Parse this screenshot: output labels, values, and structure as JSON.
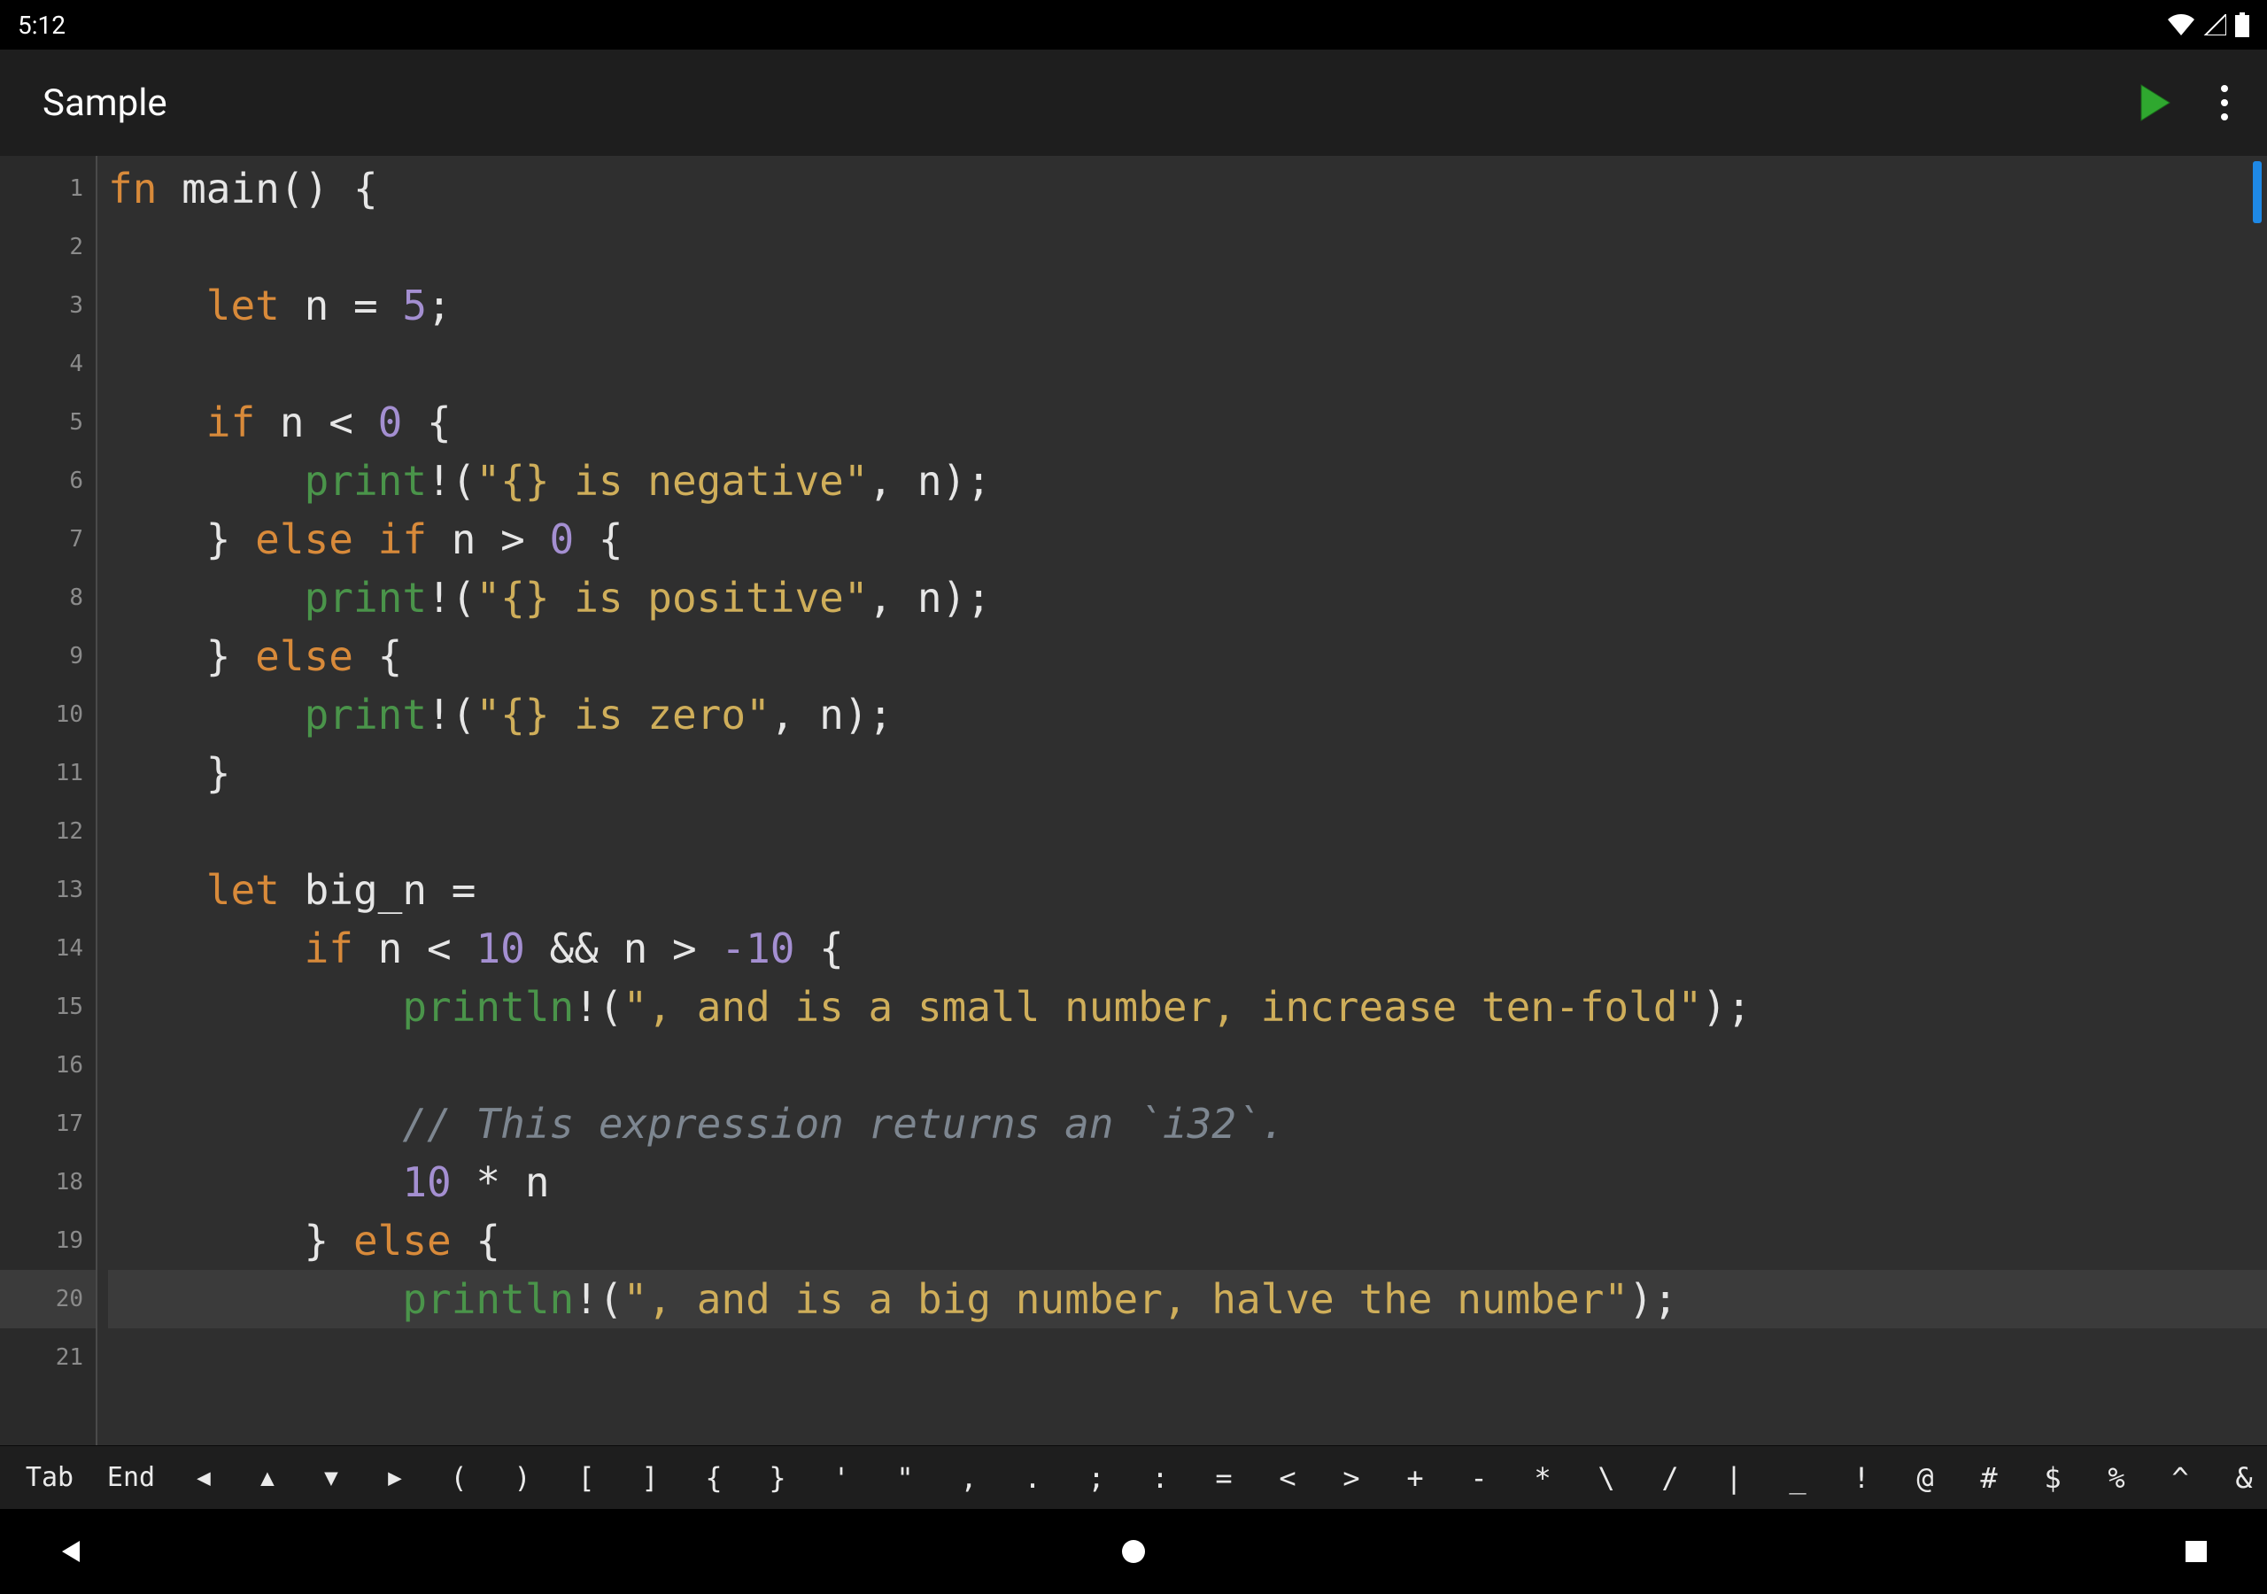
{
  "status": {
    "time": "5:12"
  },
  "header": {
    "title": "Sample"
  },
  "editor": {
    "line_count": 21,
    "current_line": 20,
    "lines": [
      [
        {
          "t": "kw",
          "v": "fn"
        },
        {
          "t": "norm",
          "v": " main() {"
        }
      ],
      [],
      [
        {
          "t": "norm",
          "v": "    "
        },
        {
          "t": "kw",
          "v": "let"
        },
        {
          "t": "norm",
          "v": " n = "
        },
        {
          "t": "num",
          "v": "5"
        },
        {
          "t": "norm",
          "v": ";"
        }
      ],
      [],
      [
        {
          "t": "norm",
          "v": "    "
        },
        {
          "t": "kw",
          "v": "if"
        },
        {
          "t": "norm",
          "v": " n < "
        },
        {
          "t": "num",
          "v": "0"
        },
        {
          "t": "norm",
          "v": " {"
        }
      ],
      [
        {
          "t": "norm",
          "v": "        "
        },
        {
          "t": "fn",
          "v": "print"
        },
        {
          "t": "norm",
          "v": "!("
        },
        {
          "t": "str",
          "v": "\"{} is negative\""
        },
        {
          "t": "norm",
          "v": ", n);"
        }
      ],
      [
        {
          "t": "norm",
          "v": "    } "
        },
        {
          "t": "kw",
          "v": "else if"
        },
        {
          "t": "norm",
          "v": " n > "
        },
        {
          "t": "num",
          "v": "0"
        },
        {
          "t": "norm",
          "v": " {"
        }
      ],
      [
        {
          "t": "norm",
          "v": "        "
        },
        {
          "t": "fn",
          "v": "print"
        },
        {
          "t": "norm",
          "v": "!("
        },
        {
          "t": "str",
          "v": "\"{} is positive\""
        },
        {
          "t": "norm",
          "v": ", n);"
        }
      ],
      [
        {
          "t": "norm",
          "v": "    } "
        },
        {
          "t": "kw",
          "v": "else"
        },
        {
          "t": "norm",
          "v": " {"
        }
      ],
      [
        {
          "t": "norm",
          "v": "        "
        },
        {
          "t": "fn",
          "v": "print"
        },
        {
          "t": "norm",
          "v": "!("
        },
        {
          "t": "str",
          "v": "\"{} is zero\""
        },
        {
          "t": "norm",
          "v": ", n);"
        }
      ],
      [
        {
          "t": "norm",
          "v": "    }"
        }
      ],
      [],
      [
        {
          "t": "norm",
          "v": "    "
        },
        {
          "t": "kw",
          "v": "let"
        },
        {
          "t": "norm",
          "v": " big_n ="
        }
      ],
      [
        {
          "t": "norm",
          "v": "        "
        },
        {
          "t": "kw",
          "v": "if"
        },
        {
          "t": "norm",
          "v": " n < "
        },
        {
          "t": "num",
          "v": "10"
        },
        {
          "t": "norm",
          "v": " && n > "
        },
        {
          "t": "num",
          "v": "-10"
        },
        {
          "t": "norm",
          "v": " {"
        }
      ],
      [
        {
          "t": "norm",
          "v": "            "
        },
        {
          "t": "fn",
          "v": "println"
        },
        {
          "t": "norm",
          "v": "!("
        },
        {
          "t": "str",
          "v": "\", and is a small number, increase ten-fold\""
        },
        {
          "t": "norm",
          "v": ");"
        }
      ],
      [],
      [
        {
          "t": "norm",
          "v": "            "
        },
        {
          "t": "cmt",
          "v": "// This expression returns an `i32`."
        }
      ],
      [
        {
          "t": "norm",
          "v": "            "
        },
        {
          "t": "num",
          "v": "10"
        },
        {
          "t": "norm",
          "v": " * n"
        }
      ],
      [
        {
          "t": "norm",
          "v": "        } "
        },
        {
          "t": "kw",
          "v": "else"
        },
        {
          "t": "norm",
          "v": " {"
        }
      ],
      [
        {
          "t": "norm",
          "v": "            "
        },
        {
          "t": "fn",
          "v": "println"
        },
        {
          "t": "norm",
          "v": "!("
        },
        {
          "t": "str",
          "v": "\", and is a big number, halve the number\""
        },
        {
          "t": "norm",
          "v": ");"
        }
      ],
      []
    ]
  },
  "symbols": {
    "keys": [
      "Tab",
      "End",
      "◀",
      "▲",
      "▼",
      "▶",
      "(",
      ")",
      "[",
      "]",
      "{",
      "}",
      "'",
      "\"",
      ",",
      ".",
      ";",
      ":",
      "=",
      "<",
      ">",
      "+",
      "-",
      "*",
      "\\",
      "/",
      "|",
      "_",
      "!",
      "@",
      "#",
      "$",
      "%",
      "^",
      "&"
    ]
  }
}
